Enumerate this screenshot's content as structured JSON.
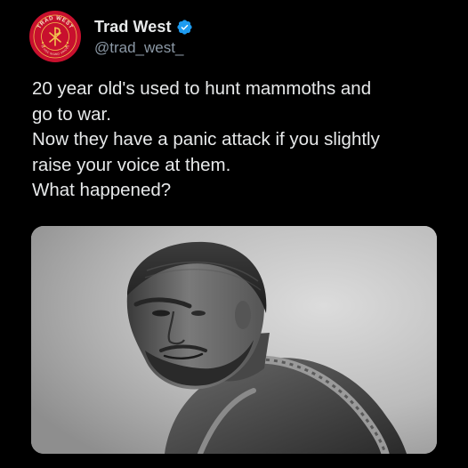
{
  "author": {
    "display_name": "Trad West",
    "handle": "@trad_west_",
    "verified": true,
    "verified_icon": "verified-badge-icon",
    "verified_color": "#1d9bf0",
    "avatar": {
      "icon": "trad-west-logo-icon",
      "ring_text": "TRAD WEST",
      "motto": "IN HOC SIGNO VINCES",
      "background": "#c8102e",
      "accent": "#f2c14e"
    }
  },
  "tweet": {
    "lines": [
      "20 year old's used to hunt mammoths and",
      "go to war.",
      "Now they have a panic attack if you slightly",
      "raise your voice at them.",
      "What happened?"
    ]
  },
  "media": {
    "kind": "image",
    "icon": "monochrome-portrait-photo"
  },
  "colors": {
    "background": "#000000",
    "text": "#e7e9ea",
    "secondary_text": "#8b98a5"
  }
}
